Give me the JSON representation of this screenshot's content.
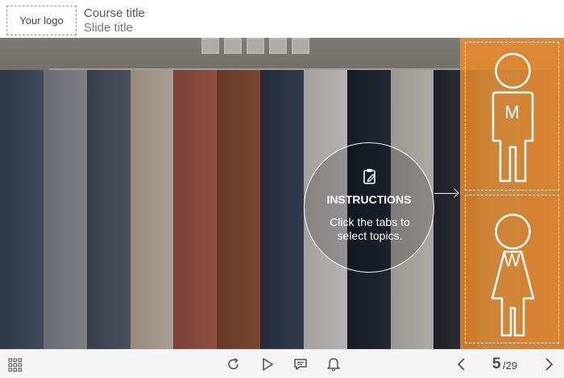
{
  "header": {
    "logo": "Your logo",
    "course_title": "Course title",
    "slide_title": "Slide title"
  },
  "instructions": {
    "icon": "clipboard-edit-icon",
    "heading": "INSTRUCTIONS",
    "text": "Click the tabs to select topics."
  },
  "tabs": [
    {
      "label": "M",
      "icon": "man-figure-icon"
    },
    {
      "label": "W",
      "icon": "woman-figure-icon"
    }
  ],
  "footer": {
    "menu_icon": "grid-menu-icon",
    "replay_icon": "replay-icon",
    "play_icon": "play-icon",
    "notes_icon": "comment-icon",
    "notify_icon": "bell-icon",
    "prev_icon": "chevron-left-icon",
    "next_icon": "chevron-right-icon",
    "current_page": "5",
    "total_pages": "/29"
  },
  "colors": {
    "accent_orange": "#f28c28",
    "header_text": "#555555",
    "footer_bg": "#f5f5f5"
  }
}
